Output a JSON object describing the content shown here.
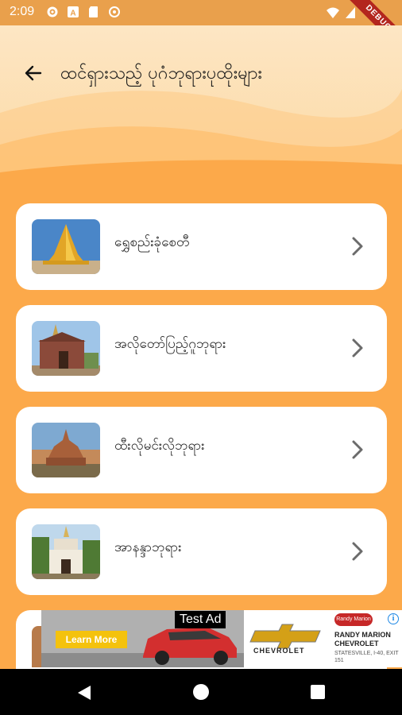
{
  "status_bar": {
    "time": "2:09",
    "debug_label": "DEBUG"
  },
  "header": {
    "title": "ထင်ရှားသည့် ပုဂံဘုရားပုထိုးများ"
  },
  "pagodas": [
    {
      "label": "ရွှေစည်းခုံစေတီ",
      "thumb_icon": "golden-stupa"
    },
    {
      "label": "အလိုတော်ပြည့်ဂူဘုရား",
      "thumb_icon": "temple-brick"
    },
    {
      "label": "ထီးလိုမင်းလိုဘုရား",
      "thumb_icon": "temple-sunset"
    },
    {
      "label": "အာနန္ဒာဘုရား",
      "thumb_icon": "temple-white"
    }
  ],
  "ad": {
    "test_label": "Test Ad",
    "cta": "Learn More",
    "brand": "CHEVROLET",
    "dealer_logo": "Randy Marion",
    "dealer_name": "RANDY MARION CHEVROLET",
    "dealer_address": "STATESVILLE, I-40, EXIT 151"
  },
  "colors": {
    "background": "#FCA94A",
    "header": "#FCD9A3",
    "card": "#FFFFFF"
  }
}
